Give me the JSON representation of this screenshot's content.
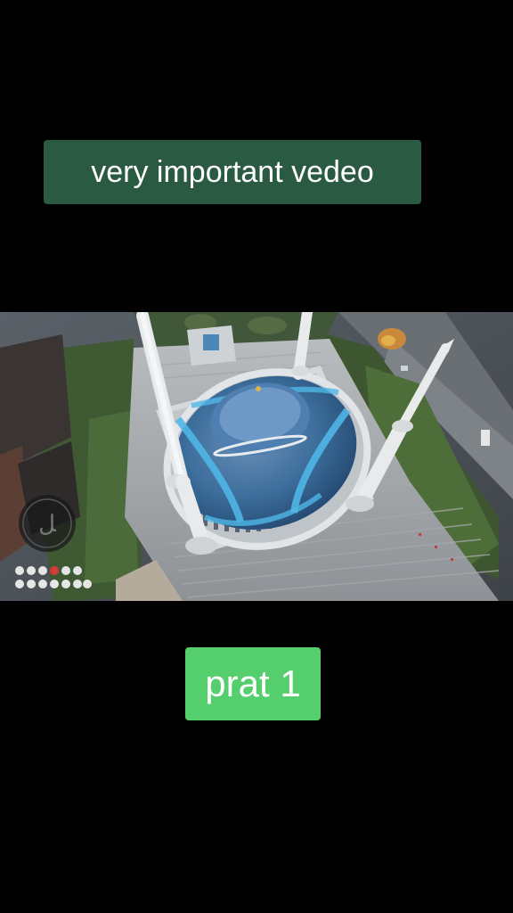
{
  "captions": {
    "top": "very important vedeo",
    "bottom": "prat 1"
  },
  "colors": {
    "background": "#000000",
    "top_caption_bg": "#2b5a43",
    "bottom_caption_bg": "#55cf6d",
    "caption_text": "#ffffff",
    "dome_blue": "#3aa3d6"
  },
  "video": {
    "subject": "aerial view of a mosque with a blue dome and four minarets",
    "watermark_icon": "channel-logo-icon"
  }
}
